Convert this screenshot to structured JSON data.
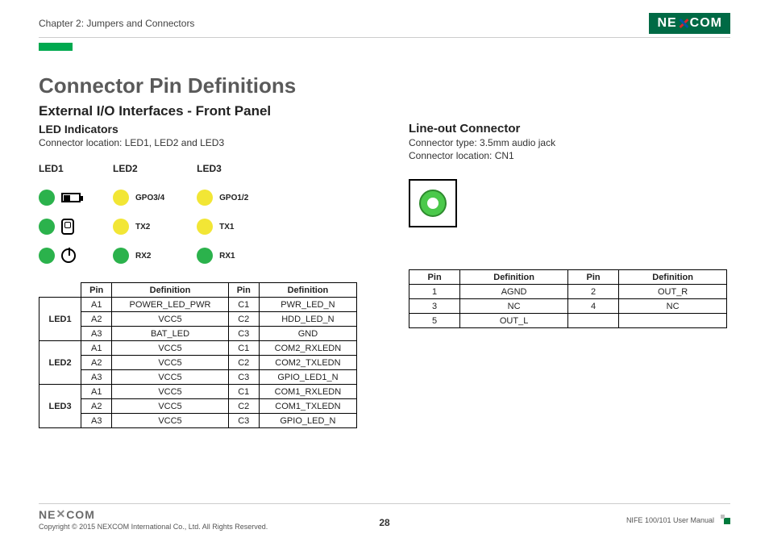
{
  "header": {
    "chapter": "Chapter 2: Jumpers and Connectors",
    "brand_left": "NE",
    "brand_right": "COM"
  },
  "title": "Connector Pin Definitions",
  "left": {
    "section": "External I/O Interfaces - Front Panel",
    "subsection": "LED Indicators",
    "location": "Connector location: LED1, LED2 and LED3",
    "led_heads": {
      "h1": "LED1",
      "h2": "LED2",
      "h3": "LED3"
    },
    "led2_labels": {
      "a": "GPO3/4",
      "b": "TX2",
      "c": "RX2"
    },
    "led3_labels": {
      "a": "GPO1/2",
      "b": "TX1",
      "c": "RX1"
    },
    "table": {
      "head": {
        "pin": "Pin",
        "def": "Definition"
      },
      "groups": [
        {
          "name": "LED1",
          "rows": [
            {
              "p1": "A1",
              "d1": "POWER_LED_PWR",
              "p2": "C1",
              "d2": "PWR_LED_N"
            },
            {
              "p1": "A2",
              "d1": "VCC5",
              "p2": "C2",
              "d2": "HDD_LED_N"
            },
            {
              "p1": "A3",
              "d1": "BAT_LED",
              "p2": "C3",
              "d2": "GND"
            }
          ]
        },
        {
          "name": "LED2",
          "rows": [
            {
              "p1": "A1",
              "d1": "VCC5",
              "p2": "C1",
              "d2": "COM2_RXLEDN"
            },
            {
              "p1": "A2",
              "d1": "VCC5",
              "p2": "C2",
              "d2": "COM2_TXLEDN"
            },
            {
              "p1": "A3",
              "d1": "VCC5",
              "p2": "C3",
              "d2": "GPIO_LED1_N"
            }
          ]
        },
        {
          "name": "LED3",
          "rows": [
            {
              "p1": "A1",
              "d1": "VCC5",
              "p2": "C1",
              "d2": "COM1_RXLEDN"
            },
            {
              "p1": "A2",
              "d1": "VCC5",
              "p2": "C2",
              "d2": "COM1_TXLEDN"
            },
            {
              "p1": "A3",
              "d1": "VCC5",
              "p2": "C3",
              "d2": "GPIO_LED_N"
            }
          ]
        }
      ]
    }
  },
  "right": {
    "section": "Line-out Connector",
    "type": "Connector type: 3.5mm audio jack",
    "location": "Connector location: CN1",
    "table": {
      "head": {
        "pin": "Pin",
        "def": "Definition"
      },
      "rows": [
        {
          "p1": "1",
          "d1": "AGND",
          "p2": "2",
          "d2": "OUT_R"
        },
        {
          "p1": "3",
          "d1": "NC",
          "p2": "4",
          "d2": "NC"
        },
        {
          "p1": "5",
          "d1": "OUT_L",
          "p2": "",
          "d2": ""
        }
      ]
    }
  },
  "footer": {
    "copyright": "Copyright © 2015 NEXCOM International Co., Ltd. All Rights Reserved.",
    "page": "28",
    "manual": "NIFE 100/101 User Manual"
  }
}
